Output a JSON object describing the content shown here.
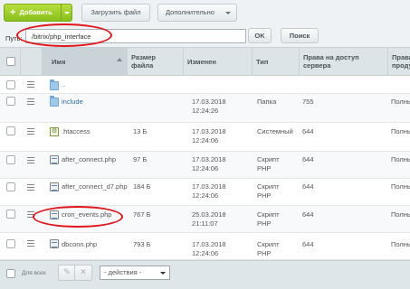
{
  "toolbar": {
    "add_label": "Добавить",
    "upload_label": "Загрузить файл",
    "more_label": "Дополнительно"
  },
  "path": {
    "label": "Путь:",
    "value": "/bitrix/php_interface",
    "ok_label": "OK",
    "search_label": "Поиск"
  },
  "table": {
    "headers": {
      "name": "Имя",
      "size": "Размер файла",
      "size_l1": "Размер",
      "size_l2": "файла",
      "modified": "Изменен",
      "type": "Тип",
      "rights_l1": "Права на доступ",
      "rights_l2": "сервера",
      "prod_l1": "Права",
      "prod_l2": "проду"
    },
    "rows": [
      {
        "name": "..",
        "size": "",
        "date": "",
        "time": "",
        "type1": "",
        "type2": "",
        "rights": "",
        "prod": "",
        "icon": "folder-icon"
      },
      {
        "name": "include",
        "size": "",
        "date": "17.03.2018",
        "time": "12:24:26",
        "type1": "Папка",
        "type2": "",
        "rights": "755",
        "prod": "Полны",
        "icon": "folder-icon"
      },
      {
        "name": ".htaccess",
        "size": "13 Б",
        "date": "17.03.2018",
        "time": "12:24:06",
        "type1": "Системный",
        "type2": "",
        "rights": "644",
        "prod": "Полны",
        "icon": "system-file-icon"
      },
      {
        "name": "after_connect.php",
        "size": "97 Б",
        "date": "17.03.2018",
        "time": "12:24:06",
        "type1": "Скрипт",
        "type2": "PHP",
        "rights": "644",
        "prod": "Полны",
        "icon": "php-file-icon"
      },
      {
        "name": "after_connect_d7.php",
        "size": "184 Б",
        "date": "17.03.2018",
        "time": "12:24:06",
        "type1": "Скрипт",
        "type2": "PHP",
        "rights": "644",
        "prod": "Полны",
        "icon": "php-file-icon"
      },
      {
        "name": "cron_events.php",
        "size": "767 Б",
        "date": "25.03.2018",
        "time": "21:11:07",
        "type1": "Скрипт",
        "type2": "PHP",
        "rights": "644",
        "prod": "Полны",
        "icon": "php-file-icon"
      },
      {
        "name": "dbconn.php",
        "size": "793 Б",
        "date": "17.03.2018",
        "time": "12:24:06",
        "type1": "Скрипт",
        "type2": "PHP",
        "rights": "644",
        "prod": "Полны",
        "icon": "php-file-icon"
      }
    ]
  },
  "footer": {
    "select_all_label": "Для всех",
    "actions_value": "- действия -"
  },
  "colors": {
    "accent_green": "#8cc21f",
    "link_blue": "#2b6fb4",
    "annotation_red": "#e0161b"
  }
}
